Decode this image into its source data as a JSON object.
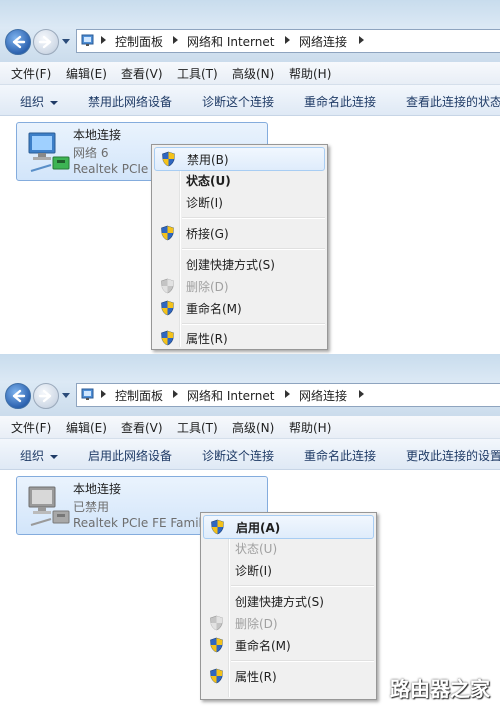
{
  "colors": {
    "accent": "#2d63b0",
    "tile_border": "#84acdd",
    "highlight_border": "#a8cdf3",
    "disabled": "#a0a0a0"
  },
  "top_window": {
    "breadcrumb": [
      "控制面板",
      "网络和 Internet",
      "网络连接"
    ],
    "menubar": [
      "文件(F)",
      "编辑(E)",
      "查看(V)",
      "工具(T)",
      "高级(N)",
      "帮助(H)"
    ],
    "commands": {
      "organize": "组织",
      "toggle_device": "禁用此网络设备",
      "diagnose": "诊断这个连接",
      "rename": "重命名此连接",
      "view_status": "查看此连接的状态"
    },
    "connection": {
      "name": "本地连接",
      "status": "网络  6",
      "device": "Realtek PCIe"
    },
    "context_menu": {
      "disable": "禁用(B)",
      "status": "状态(U)",
      "diagnose": "诊断(I)",
      "bridge": "桥接(G)",
      "shortcut": "创建快捷方式(S)",
      "delete": "删除(D)",
      "rename": "重命名(M)",
      "properties": "属性(R)"
    }
  },
  "bottom_window": {
    "breadcrumb": [
      "控制面板",
      "网络和 Internet",
      "网络连接"
    ],
    "menubar": [
      "文件(F)",
      "编辑(E)",
      "查看(V)",
      "工具(T)",
      "高级(N)",
      "帮助(H)"
    ],
    "commands": {
      "organize": "组织",
      "toggle_device": "启用此网络设备",
      "diagnose": "诊断这个连接",
      "rename": "重命名此连接",
      "change_settings": "更改此连接的设置"
    },
    "connection": {
      "name": "本地连接",
      "status": "已禁用",
      "device": "Realtek PCIe FE Family"
    },
    "context_menu": {
      "enable": "启用(A)",
      "status": "状态(U)",
      "diagnose": "诊断(I)",
      "shortcut": "创建快捷方式(S)",
      "delete": "删除(D)",
      "rename": "重命名(M)",
      "properties": "属性(R)"
    }
  },
  "watermark": "路由器之家"
}
